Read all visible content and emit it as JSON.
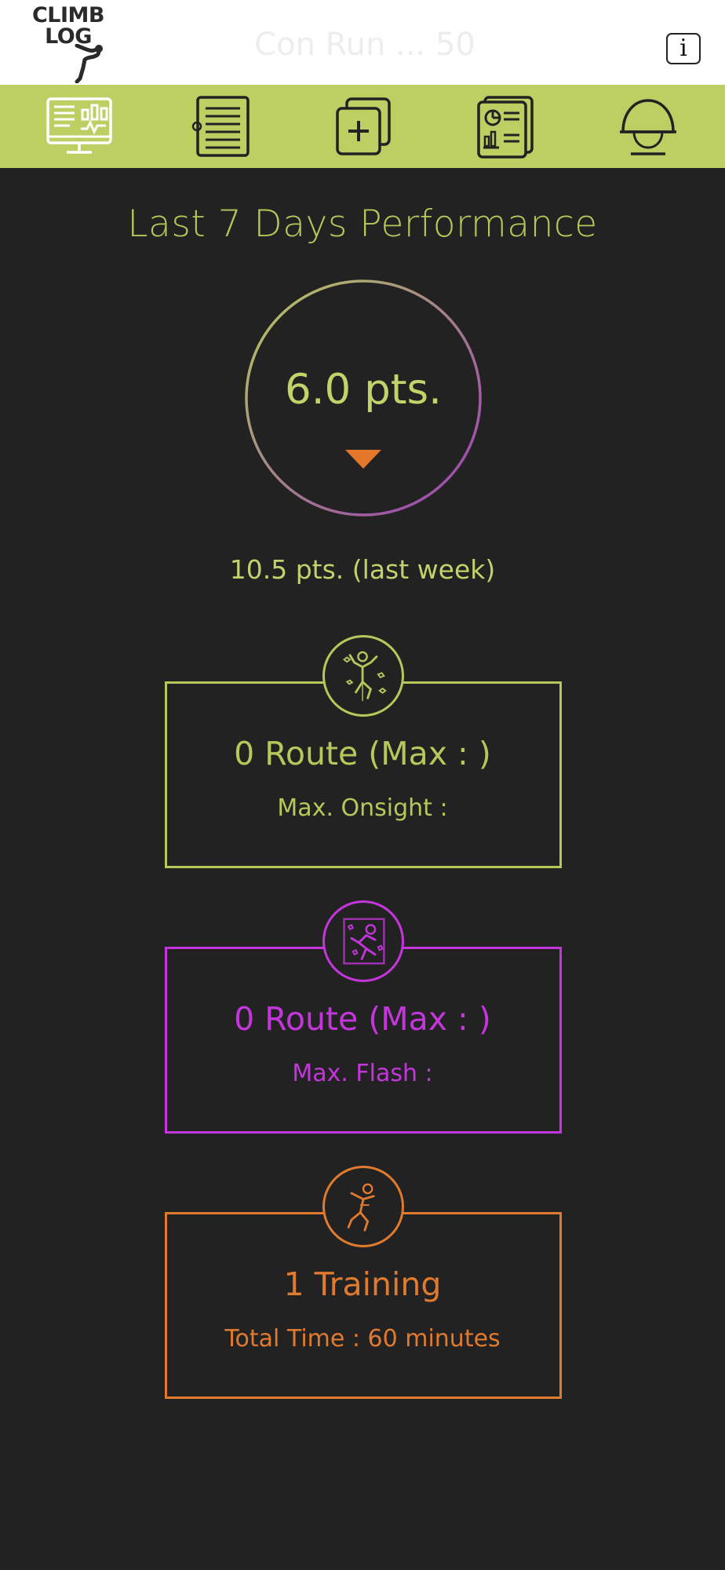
{
  "header": {
    "logo_text": "CLIMB\nLOG",
    "title": "Con Run ... 50",
    "info_label": "i"
  },
  "nav": {
    "items": [
      {
        "icon": "dashboard-monitor-icon"
      },
      {
        "icon": "log-list-icon"
      },
      {
        "icon": "add-entry-icon"
      },
      {
        "icon": "reports-icon"
      },
      {
        "icon": "climbing-helmet-icon"
      }
    ]
  },
  "performance": {
    "title": "Last 7 Days Performance",
    "points": "6.0 pts.",
    "trend": "down",
    "last_week": "10.5 pts. (last week)"
  },
  "cards": {
    "onsight": {
      "main": "0 Route (Max : )",
      "sub": "Max. Onsight :",
      "color": "#b4c95a"
    },
    "flash": {
      "main": "0 Route (Max : )",
      "sub": "Max. Flash :",
      "color": "#c436dc"
    },
    "training": {
      "main": "1 Training",
      "sub": "Total Time : 60 minutes",
      "color": "#e07a2e"
    }
  },
  "colors": {
    "accent_green": "#bdcf62",
    "background": "#222222",
    "arrow_orange": "#e5772a"
  }
}
